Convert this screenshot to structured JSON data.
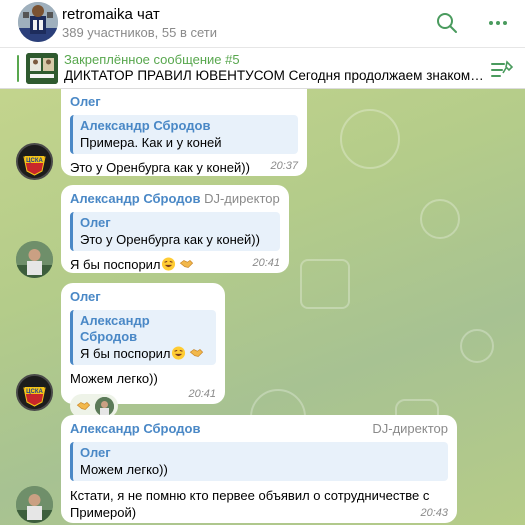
{
  "header": {
    "title": "retromaika чат",
    "subtitle": "389 участников, 55 в сети"
  },
  "pinned": {
    "title": "Закреплённое сообщение #5",
    "text": "ДИКТАТОР ПРАВИЛ ЮВЕНТУСОМ  Сегодня продолжаем знаком…"
  },
  "messages": [
    {
      "sender": "Олег",
      "quote_name": "Александр Сбродов",
      "quote_text": "Примера. Как и у коней",
      "text": "Это у Оренбурга как у коней))",
      "time": "20:37"
    },
    {
      "sender": "Александр Сбродов",
      "role": "DJ-директор",
      "quote_name": "Олег",
      "quote_text": "Это у Оренбурга как у коней))",
      "text": "Я бы поспорил",
      "time": "20:41"
    },
    {
      "sender": "Олег",
      "quote_name": "Александр Сбродов",
      "quote_text": "Я бы поспорил",
      "text": "Можем легко))",
      "time": "20:41"
    },
    {
      "sender": "Александр Сбродов",
      "role": "DJ-директор",
      "quote_name": "Олег",
      "quote_text": "Можем легко))",
      "text_line1": "Кстати, я не помню кто первее объявил о сотрудничестве с",
      "text_line2": "Примерой)",
      "time": "20:43"
    }
  ],
  "colors": {
    "accent": "#4a88c6",
    "pinned_accent": "#58a74e",
    "bubble": "#ffffff"
  },
  "icons": [
    "search-icon",
    "more-icon",
    "pinned-list-icon",
    "laughing-emoji-icon",
    "handshake-emoji-icon"
  ]
}
